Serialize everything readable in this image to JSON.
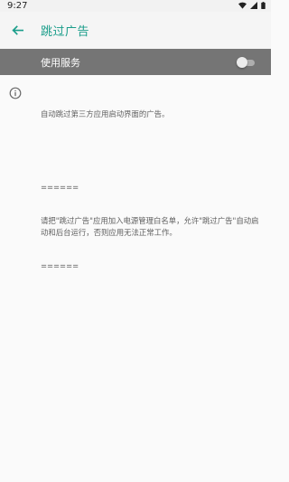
{
  "status_bar": {
    "time": "9:27",
    "icons": [
      "wifi-icon",
      "signal-icon",
      "battery-icon"
    ]
  },
  "app_bar": {
    "title": "跳过广告",
    "back_icon": "arrow-back-icon"
  },
  "service_switch": {
    "label": "使用服务",
    "enabled": false
  },
  "info": {
    "icon": "info-icon",
    "description": "自动跳过第三方应用启动界面的广告。",
    "note_line1": "======",
    "note_body": "请把\"跳过广告\"应用加入电源管理白名单，允许\"跳过广告\"自动启动和后台运行，否则应用无法正常工作。",
    "note_line2": "======"
  },
  "colors": {
    "accent": "#1a9d8a",
    "switch_bar": "#757575",
    "background": "#fafafa"
  }
}
